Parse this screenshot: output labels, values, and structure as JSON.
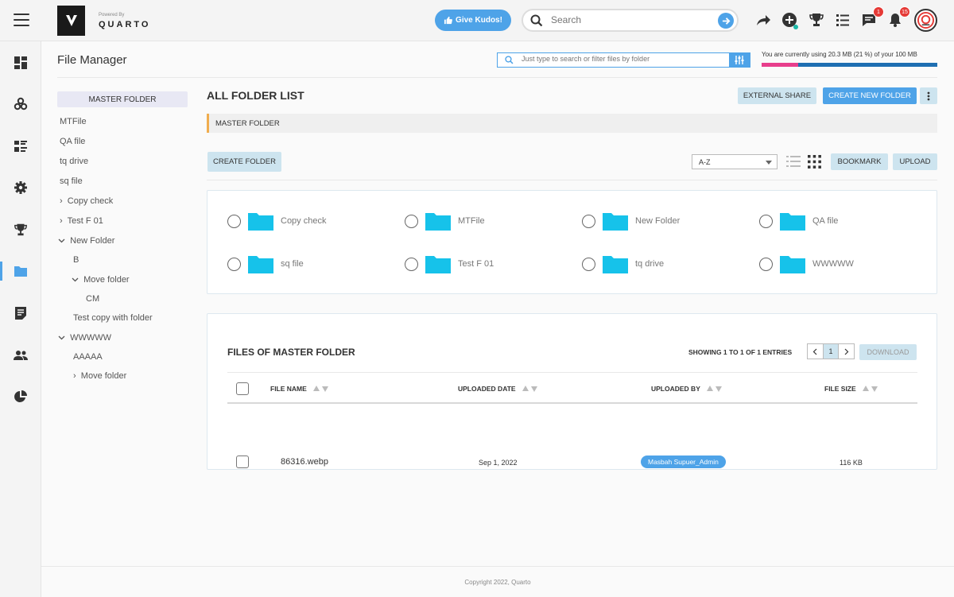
{
  "header": {
    "brand_powered": "Powered By",
    "brand_name": "QUARTO",
    "kudos_label": "Give Kudos!",
    "search_placeholder": "Search",
    "message_badge": "1",
    "notification_badge": "15"
  },
  "nav": {
    "items": [
      "dashboard-icon",
      "modules-icon",
      "list-icon",
      "settings-icon",
      "trophy-icon",
      "folder-icon",
      "notes-icon",
      "users-icon",
      "pie-chart-icon"
    ],
    "active": "folder-icon"
  },
  "page": {
    "title": "File Manager",
    "file_search_placeholder": "Just type to search or filter files by folder",
    "usage_text": "You are currently using 20.3 MB (21 %) of your 100 MB",
    "usage_percent": 21
  },
  "tree": {
    "root": "MASTER FOLDER",
    "items": [
      "MTFile",
      "QA file",
      "tq drive",
      "sq file",
      "Copy check",
      "Test F 01",
      "New Folder",
      "B",
      "Move folder",
      "CM",
      "Test copy with folder",
      "WWWWW",
      "AAAAA",
      "Move folder"
    ]
  },
  "content": {
    "title": "ALL FOLDER LIST",
    "external_share": "EXTERNAL SHARE",
    "create_new_folder": "CREATE NEW FOLDER",
    "breadcrumb": "MASTER FOLDER",
    "create_folder": "CREATE FOLDER",
    "sort_value": "A-Z",
    "bookmark": "BOOKMARK",
    "upload": "UPLOAD",
    "folders": [
      "Copy check",
      "MTFile",
      "New Folder",
      "QA file",
      "sq file",
      "Test F 01",
      "tq drive",
      "WWWWW"
    ]
  },
  "files": {
    "title": "FILES OF MASTER FOLDER",
    "showing": "SHOWING 1 TO 1 OF 1 ENTRIES",
    "page": "1",
    "download": "DOWNLOAD",
    "columns": [
      "FILE NAME",
      "UPLOADED DATE",
      "UPLOADED BY",
      "FILE SIZE"
    ],
    "rows": [
      {
        "name": "86316.webp",
        "date": "Sep 1, 2022",
        "by": "Masbah Supuer_Admin",
        "size": "116 KB"
      }
    ]
  },
  "footer": "Copyright 2022, Quarto",
  "colors": {
    "accent": "#4ea3e8",
    "light_button": "#cde4ef",
    "folder": "#16c2ea",
    "usage_used": "#e83e8c",
    "usage_free": "#1f6fb2"
  }
}
